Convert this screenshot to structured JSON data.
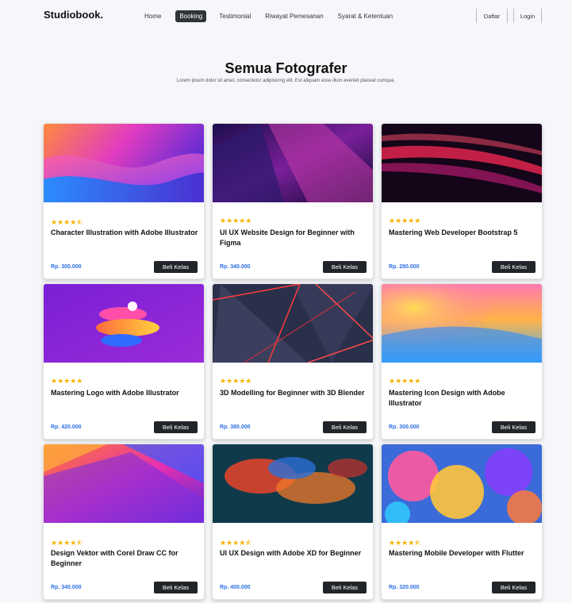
{
  "navbar": {
    "brand": "Studiobook.",
    "links": [
      "Home",
      "Booking",
      "Testimonial",
      "Riwayat Pemesanan",
      "Syarat & Ketentuan"
    ],
    "active": "Booking",
    "register": "Daftar",
    "login": "Login"
  },
  "hero": {
    "title": "Semua Fotografer",
    "subtitle": "Lorem ipsum dolor sit amet, consectetur adipisicing elit. Est aliquam esse illum eveniet placeat cumque."
  },
  "colors": {
    "accent_price": "#2d6fe0",
    "button": "#212529",
    "star": "#f5b301"
  },
  "cards": [
    {
      "stars": "★★★★⯪",
      "title": "Character Illustration with Adobe Illustrator",
      "price": "Rp. 300.000",
      "button": "Beli Kelas",
      "image": "wave-gradient"
    },
    {
      "stars": "★★★★★",
      "title": "UI UX Website Design for Beginner with Figma",
      "price": "Rp. 340.000",
      "button": "Beli Kelas",
      "image": "purple-glass"
    },
    {
      "stars": "★★★★★",
      "title": "Mastering Web Developer Bootstrap 5",
      "price": "Rp. 280.000",
      "button": "Beli Kelas",
      "image": "red-light-streaks"
    },
    {
      "stars": "★★★★★",
      "title": "Mastering Logo with Adobe Illustrator",
      "price": "Rp. 420.000",
      "button": "Beli Kelas",
      "image": "3d-rings"
    },
    {
      "stars": "★★★★★",
      "title": "3D Modelling for Beginner with 3D Blender",
      "price": "Rp. 380.000",
      "button": "Beli Kelas",
      "image": "neon-triangles"
    },
    {
      "stars": "★★★★★",
      "title": "Mastering Icon Design with Adobe Illustrator",
      "price": "Rp. 300.000",
      "button": "Beli Kelas",
      "image": "mesh-gradient"
    },
    {
      "stars": "★★★★⯪",
      "title": "Design Vektor with Corel Draw CC for Beginner",
      "price": "Rp. 340.000",
      "button": "Beli Kelas",
      "image": "folded-planes"
    },
    {
      "stars": "★★★★⯪",
      "title": "UI UX Design with Adobe XD for Beginner",
      "price": "Rp. 400.000",
      "button": "Beli Kelas",
      "image": "ink-smoke"
    },
    {
      "stars": "★★★★⯪",
      "title": "Mastering Mobile Developer with Flutter",
      "price": "Rp. 320.000",
      "button": "Beli Kelas",
      "image": "colorful-bubbles"
    }
  ]
}
